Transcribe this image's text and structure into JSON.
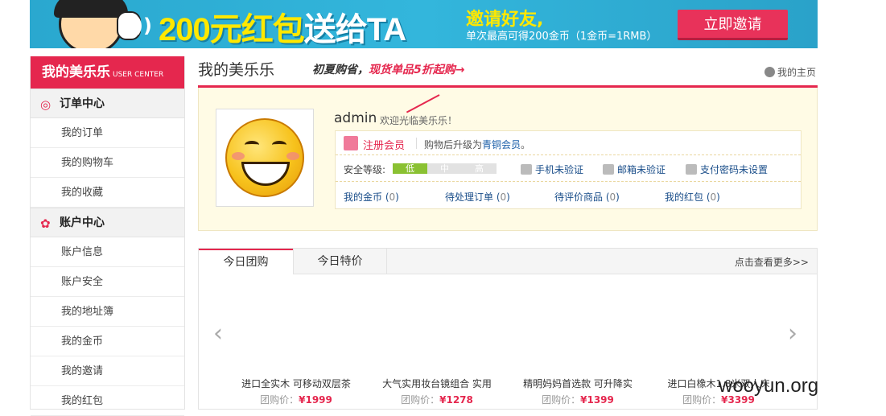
{
  "banner": {
    "headline_num": "200元红包",
    "headline_rest": "送给TA",
    "invite_title": "邀请好友,",
    "invite_sub": "单次最高可得200金币（1金币=1RMB）",
    "cta": "立即邀请"
  },
  "sidebar": {
    "title": "我的美乐乐",
    "title_sub": "USER CENTER",
    "groups": [
      {
        "label": "订单中心",
        "items": [
          "我的订单",
          "我的购物车",
          "我的收藏"
        ]
      },
      {
        "label": "账户中心",
        "items": [
          "账户信息",
          "账户安全",
          "我的地址簿",
          "我的金币",
          "我的邀请",
          "我的红包"
        ]
      }
    ]
  },
  "header": {
    "title": "我的美乐乐",
    "promo_a": "初夏购省，",
    "promo_b": "现货单品5折起购→",
    "home_link": "我的主页"
  },
  "profile": {
    "username": "admin",
    "welcome": "欢迎光临美乐乐！",
    "member": "注册会员",
    "upgrade_text": "购物后升级为",
    "upgrade_link": "青铜会员",
    "upgrade_end": "。",
    "security_label": "安全等级:",
    "levels": [
      "低",
      "中",
      "高"
    ],
    "checks": [
      "手机未验证",
      "邮箱未验证",
      "支付密码未设置"
    ],
    "stats": [
      {
        "label": "我的金币",
        "value": "0"
      },
      {
        "label": "待处理订单",
        "value": "0"
      },
      {
        "label": "待评价商品",
        "value": "0"
      },
      {
        "label": "我的红包",
        "value": "0"
      }
    ]
  },
  "deals": {
    "tabs": [
      "今日团购",
      "今日特价"
    ],
    "more": "点击查看更多>>",
    "products": [
      {
        "name": "进口全实木 可移动双层茶",
        "price_label": "团购价：",
        "price": "¥1999"
      },
      {
        "name": "大气实用妆台镜组合 实用",
        "price_label": "团购价：",
        "price": "¥1278"
      },
      {
        "name": "精明妈妈首选款 可升降实",
        "price_label": "团购价：",
        "price": "¥1399"
      },
      {
        "name": "进口白橡木1.8米双人床",
        "price_label": "团购价：",
        "price": "¥3399"
      }
    ]
  },
  "watermark": "wooyun.org"
}
